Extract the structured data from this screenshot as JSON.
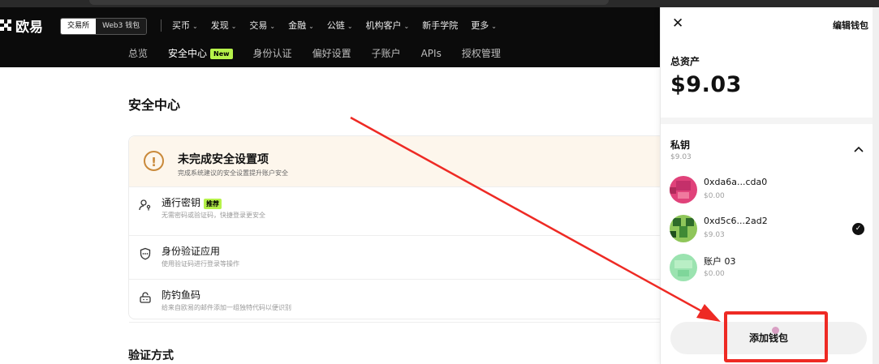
{
  "brand": {
    "name": "欧易"
  },
  "top_segment": {
    "exchange": "交易所",
    "web3": "Web3 钱包"
  },
  "nav": [
    "买币",
    "发现",
    "交易",
    "金融",
    "公链",
    "机构客户",
    "新手学院",
    "更多"
  ],
  "nav_chevron_flags": [
    true,
    true,
    true,
    true,
    true,
    true,
    false,
    true
  ],
  "subnav": {
    "items": [
      "总览",
      "安全中心",
      "身份认证",
      "偏好设置",
      "子账户",
      "APIs",
      "授权管理"
    ],
    "active_index": 1,
    "new_badge": "New"
  },
  "page": {
    "title": "安全中心",
    "warning": {
      "title": "未完成安全设置项",
      "subtitle": "完成系统建议的安全设置提升账户安全"
    },
    "items": [
      {
        "title": "通行密钥",
        "tag": "推荐",
        "subtitle": "无需密码或验证码，快捷登录更安全",
        "icon": "passkey-user-icon"
      },
      {
        "title": "身份验证应用",
        "tag": "",
        "subtitle": "使用验证码进行登录等操作",
        "icon": "authenticator-shield-icon"
      },
      {
        "title": "防钓鱼码",
        "tag": "",
        "subtitle": "给来自欧易的邮件添加一组独特代码以便识别",
        "icon": "anti-phishing-lock-icon"
      }
    ],
    "section2_title": "验证方式"
  },
  "wallet_panel": {
    "close_icon": "close-icon",
    "edit_label": "编辑钱包",
    "total_label": "总资产",
    "total_value": "$9.03",
    "group": {
      "title": "私钥",
      "subtitle": "$9.03",
      "expanded": true
    },
    "accounts": [
      {
        "name": "0xda6a...cda0",
        "balance": "$0.00",
        "selected": false
      },
      {
        "name": "0xd5c6...2ad2",
        "balance": "$9.03",
        "selected": true
      },
      {
        "name": "账户 03",
        "balance": "$0.00",
        "selected": false
      }
    ],
    "add_button": "添加钱包"
  },
  "colors": {
    "topbar": "#0b0b0b",
    "accent_green": "#b6f24a",
    "warning_bg": "#fdf6ec",
    "warning_icon": "#c9893a",
    "annotation_red": "#ee2a24"
  }
}
